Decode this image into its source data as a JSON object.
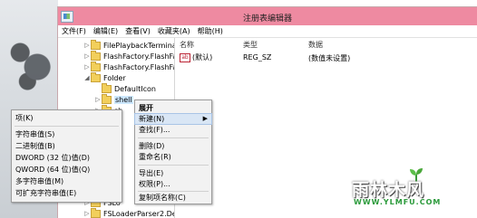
{
  "window": {
    "title": "注册表编辑器"
  },
  "menubar": {
    "items": [
      "文件(F)",
      "编辑(E)",
      "查看(V)",
      "收藏夹(A)",
      "帮助(H)"
    ]
  },
  "tree": {
    "items": [
      {
        "label": "FilePlaybackTerminal"
      },
      {
        "label": "FlashFactory.FlashFa"
      },
      {
        "label": "FlashFactory.FlashFa"
      },
      {
        "label": "Folder"
      },
      {
        "label": "DefaultIcon"
      },
      {
        "label": "shell"
      },
      {
        "label": "sh"
      },
      {
        "label": "FSLo"
      },
      {
        "label": "FSLoaderParser2.De"
      }
    ]
  },
  "values": {
    "headers": {
      "name": "名称",
      "type": "类型",
      "data": "数据"
    },
    "rows": [
      {
        "name": "(默认)",
        "type": "REG_SZ",
        "data": "(数值未设置)"
      }
    ]
  },
  "context_menu": {
    "items": [
      "展开",
      "新建(N)",
      "查找(F)...",
      "删除(D)",
      "重命名(R)",
      "导出(E)",
      "权限(P)...",
      "复制项名称(C)"
    ]
  },
  "submenu": {
    "items": [
      "项(K)",
      "字符串值(S)",
      "二进制值(B)",
      "DWORD (32 位)值(D)",
      "QWORD (64 位)值(Q)",
      "多字符串值(M)",
      "可扩充字符串值(E)"
    ]
  },
  "watermark": {
    "text": "雨林木风",
    "sub": "WWW.YLMFU.COM"
  }
}
